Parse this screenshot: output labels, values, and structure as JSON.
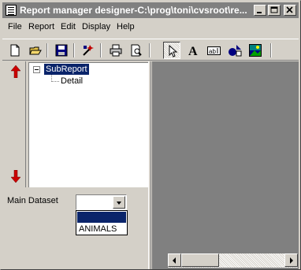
{
  "window": {
    "title": "Report manager designer-C:\\prog\\toni\\cvsroot\\re...",
    "controls": [
      "minimize",
      "maximize",
      "close"
    ]
  },
  "menu": [
    "File",
    "Report",
    "Edit",
    "Display",
    "Help"
  ],
  "toolbar": {
    "icons": [
      "new-file-icon",
      "open-folder-icon",
      "save-icon",
      "wizard-icon",
      "print-icon",
      "print-preview-icon",
      "select-arrow-icon",
      "text-label-icon",
      "edit-field-icon",
      "shapes-icon",
      "image-icon"
    ]
  },
  "tree": {
    "root": "SubReport",
    "children": [
      "Detail"
    ]
  },
  "dataset": {
    "label": "Main Dataset",
    "value": "",
    "options": [
      "",
      "ANIMALS"
    ]
  },
  "colors": {
    "face": "#d4d0c8",
    "titlebar_inactive": "#808080",
    "selection": "#0a246a",
    "arrow_red": "#cc0000"
  }
}
